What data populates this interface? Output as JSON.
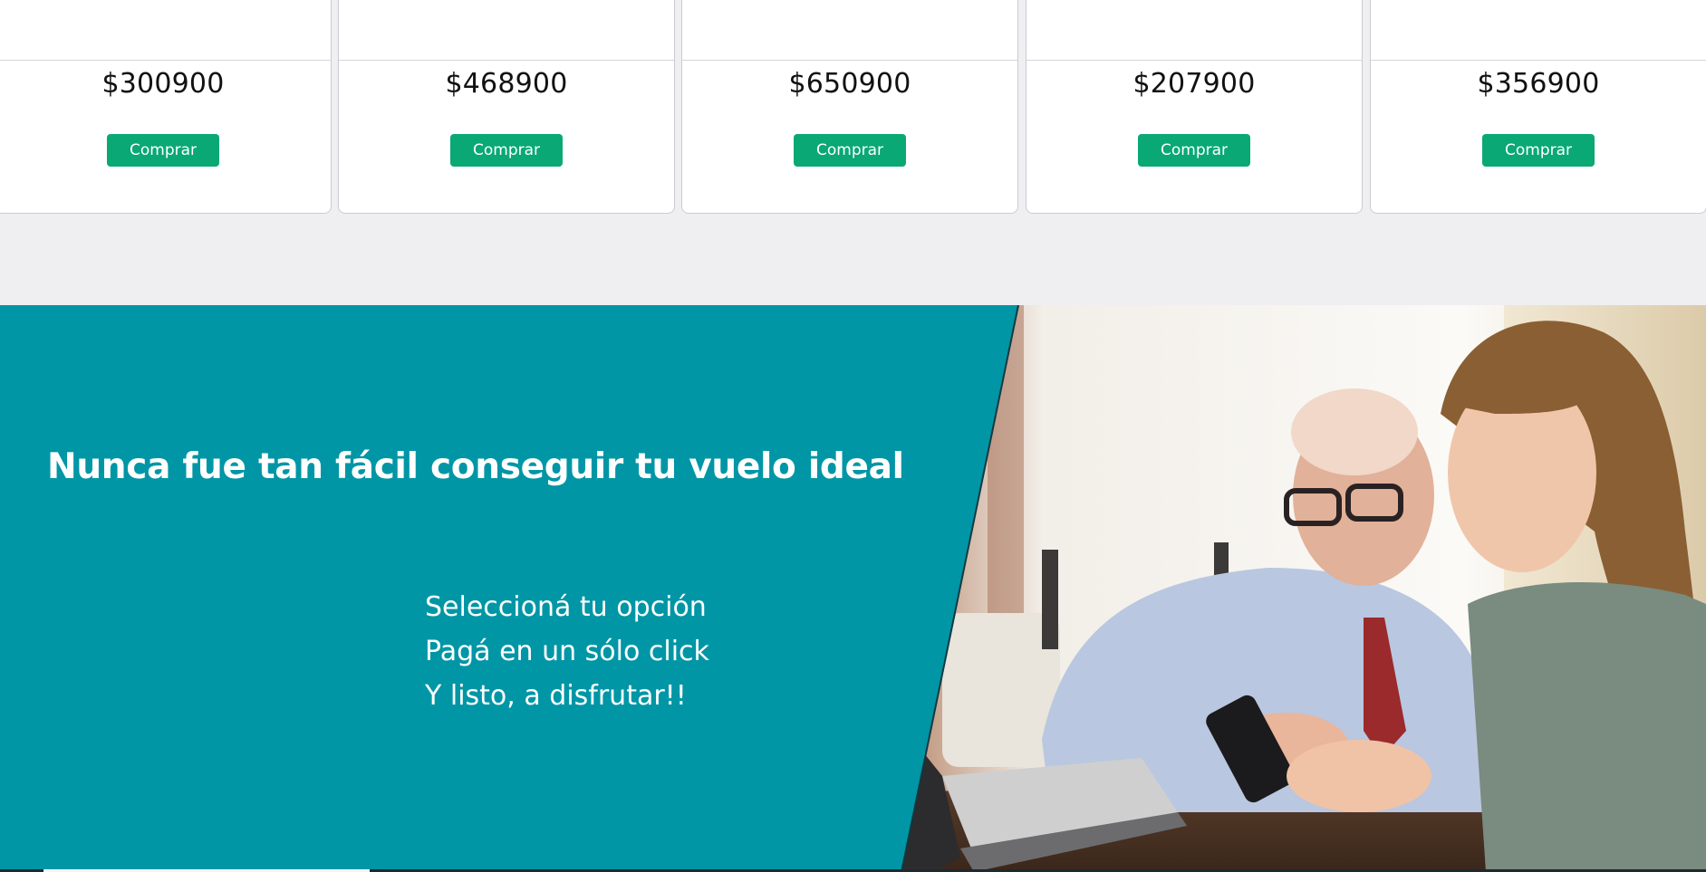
{
  "products": [
    {
      "price": "$300900",
      "button_label": "Comprar"
    },
    {
      "price": "$468900",
      "button_label": "Comprar"
    },
    {
      "price": "$650900",
      "button_label": "Comprar"
    },
    {
      "price": "$207900",
      "button_label": "Comprar"
    },
    {
      "price": "$356900",
      "button_label": "Comprar"
    }
  ],
  "hero": {
    "title": "Nunca fue tan fácil conseguir tu vuelo ideal",
    "steps": [
      "Seleccioná tu opción",
      "Pagá en un sólo click",
      "Y listo, a disfrutar!!"
    ],
    "photo": "two-people-looking-at-phone-photo"
  },
  "colors": {
    "page_background": "#efeff1",
    "buy_button": "#0aa874",
    "hero_panel": "#0096a6",
    "text_on_hero": "#ffffff"
  }
}
